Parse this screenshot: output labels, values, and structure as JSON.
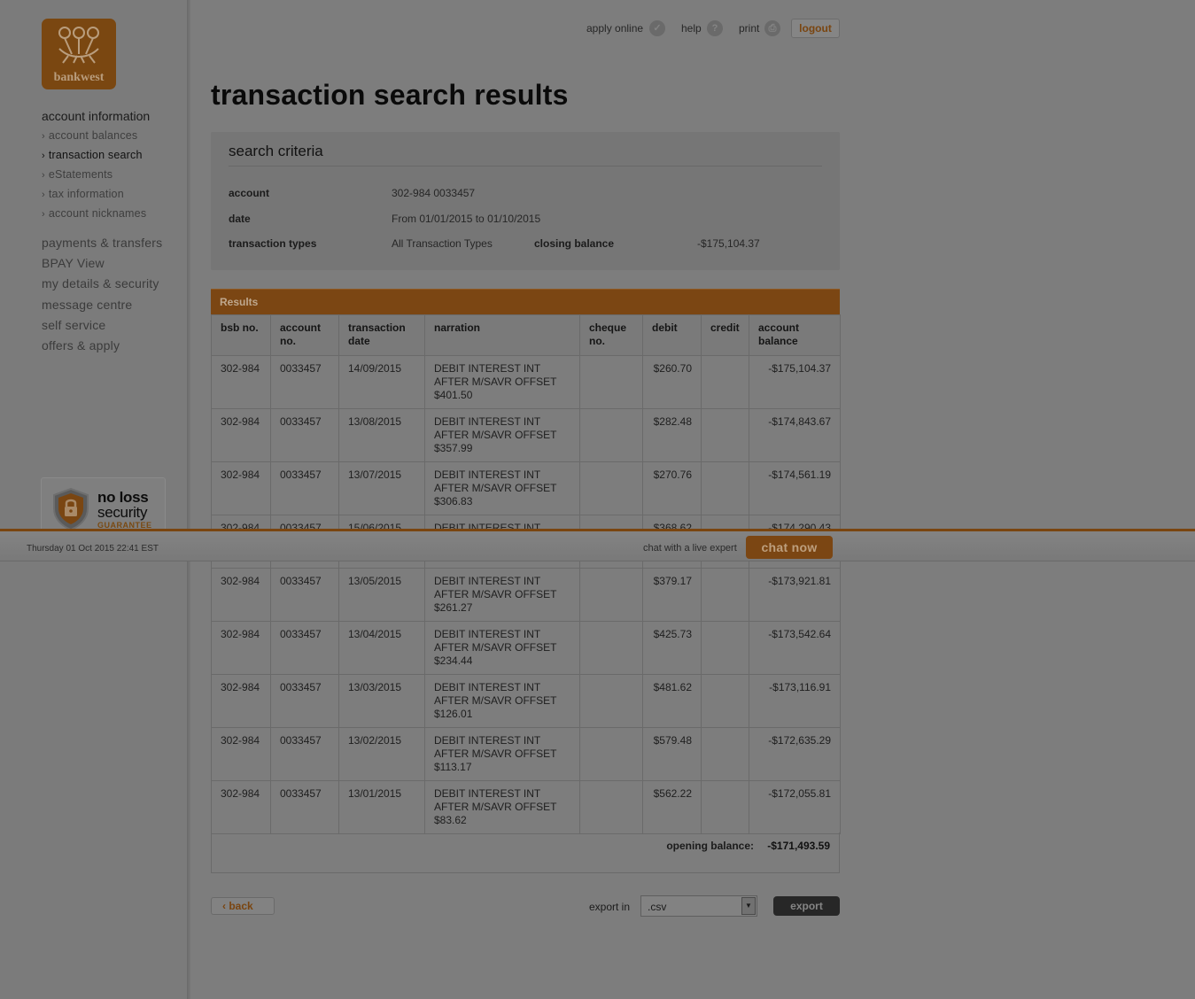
{
  "logo": {
    "brand": "bankwest"
  },
  "sidebar": {
    "heading": "account information",
    "subitems": [
      {
        "label": "account balances"
      },
      {
        "label": "transaction search"
      },
      {
        "label": "eStatements"
      },
      {
        "label": "tax information"
      },
      {
        "label": "account nicknames"
      }
    ],
    "items": [
      {
        "label": "payments & transfers"
      },
      {
        "label": "BPAY View"
      },
      {
        "label": "my details & security"
      },
      {
        "label": "message centre"
      },
      {
        "label": "self service"
      },
      {
        "label": "offers & apply"
      }
    ],
    "badge": {
      "line1": "no loss",
      "line2": "security",
      "line3": "GUARANTEE"
    }
  },
  "toplinks": {
    "apply_online": "apply online",
    "help": "help",
    "print": "print",
    "logout": "logout"
  },
  "page_title": "transaction search results",
  "criteria": {
    "title": "search criteria",
    "account_label": "account",
    "account_value": "302-984 0033457",
    "date_label": "date",
    "date_value": "From 01/01/2015 to 01/10/2015",
    "types_label": "transaction types",
    "types_value": "All Transaction Types",
    "closing_label": "closing balance",
    "closing_value": "-$175,104.37"
  },
  "results": {
    "title": "Results",
    "headers": {
      "bsb": "bsb no.",
      "account_1": "account",
      "account_2": "no.",
      "date_1": "transaction",
      "date_2": "date",
      "narration": "narration",
      "cheque_1": "cheque",
      "cheque_2": "no.",
      "debit": "debit",
      "credit": "credit",
      "balance_1": "account",
      "balance_2": "balance"
    },
    "rows": [
      {
        "bsb": "302-984",
        "account": "0033457",
        "date": "14/09/2015",
        "n1": "DEBIT INTEREST INT",
        "n2": "AFTER M/SAVR OFFSET",
        "n3": "$401.50",
        "cheque": "",
        "debit": "$260.70",
        "credit": "",
        "balance": "-$175,104.37"
      },
      {
        "bsb": "302-984",
        "account": "0033457",
        "date": "13/08/2015",
        "n1": "DEBIT INTEREST INT",
        "n2": "AFTER M/SAVR OFFSET",
        "n3": "$357.99",
        "cheque": "",
        "debit": "$282.48",
        "credit": "",
        "balance": "-$174,843.67"
      },
      {
        "bsb": "302-984",
        "account": "0033457",
        "date": "13/07/2015",
        "n1": "DEBIT INTEREST INT",
        "n2": "AFTER M/SAVR OFFSET",
        "n3": "$306.83",
        "cheque": "",
        "debit": "$270.76",
        "credit": "",
        "balance": "-$174,561.19"
      },
      {
        "bsb": "302-984",
        "account": "0033457",
        "date": "15/06/2015",
        "n1": "DEBIT INTEREST INT",
        "n2": "",
        "n3": "",
        "cheque": "",
        "debit": "$368.62",
        "credit": "",
        "balance": "-$174,290.43"
      },
      {
        "bsb": "302-984",
        "account": "0033457",
        "date": "13/05/2015",
        "n1": "DEBIT INTEREST INT",
        "n2": "AFTER M/SAVR OFFSET",
        "n3": "$261.27",
        "cheque": "",
        "debit": "$379.17",
        "credit": "",
        "balance": "-$173,921.81"
      },
      {
        "bsb": "302-984",
        "account": "0033457",
        "date": "13/04/2015",
        "n1": "DEBIT INTEREST INT",
        "n2": "AFTER M/SAVR OFFSET",
        "n3": "$234.44",
        "cheque": "",
        "debit": "$425.73",
        "credit": "",
        "balance": "-$173,542.64"
      },
      {
        "bsb": "302-984",
        "account": "0033457",
        "date": "13/03/2015",
        "n1": "DEBIT INTEREST INT",
        "n2": "AFTER M/SAVR OFFSET",
        "n3": "$126.01",
        "cheque": "",
        "debit": "$481.62",
        "credit": "",
        "balance": "-$173,116.91"
      },
      {
        "bsb": "302-984",
        "account": "0033457",
        "date": "13/02/2015",
        "n1": "DEBIT INTEREST INT",
        "n2": "AFTER M/SAVR OFFSET",
        "n3": "$113.17",
        "cheque": "",
        "debit": "$579.48",
        "credit": "",
        "balance": "-$172,635.29"
      },
      {
        "bsb": "302-984",
        "account": "0033457",
        "date": "13/01/2015",
        "n1": "DEBIT INTEREST INT",
        "n2": "AFTER M/SAVR OFFSET",
        "n3": "$83.62",
        "cheque": "",
        "debit": "$562.22",
        "credit": "",
        "balance": "-$172,055.81"
      }
    ],
    "opening_label": "opening balance:",
    "opening_value": "-$171,493.59"
  },
  "bottom": {
    "back": "back",
    "export_label": "export in",
    "export_format": ".csv",
    "export_button": "export"
  },
  "overlay": {
    "datetime": "Thursday 01 Oct 2015 22:41 EST",
    "chat_label": "chat with a live expert",
    "chat_button": "chat now"
  },
  "colors": {
    "brand_orange": "#7b4613",
    "overlay_dim": "#7d7d7d"
  }
}
